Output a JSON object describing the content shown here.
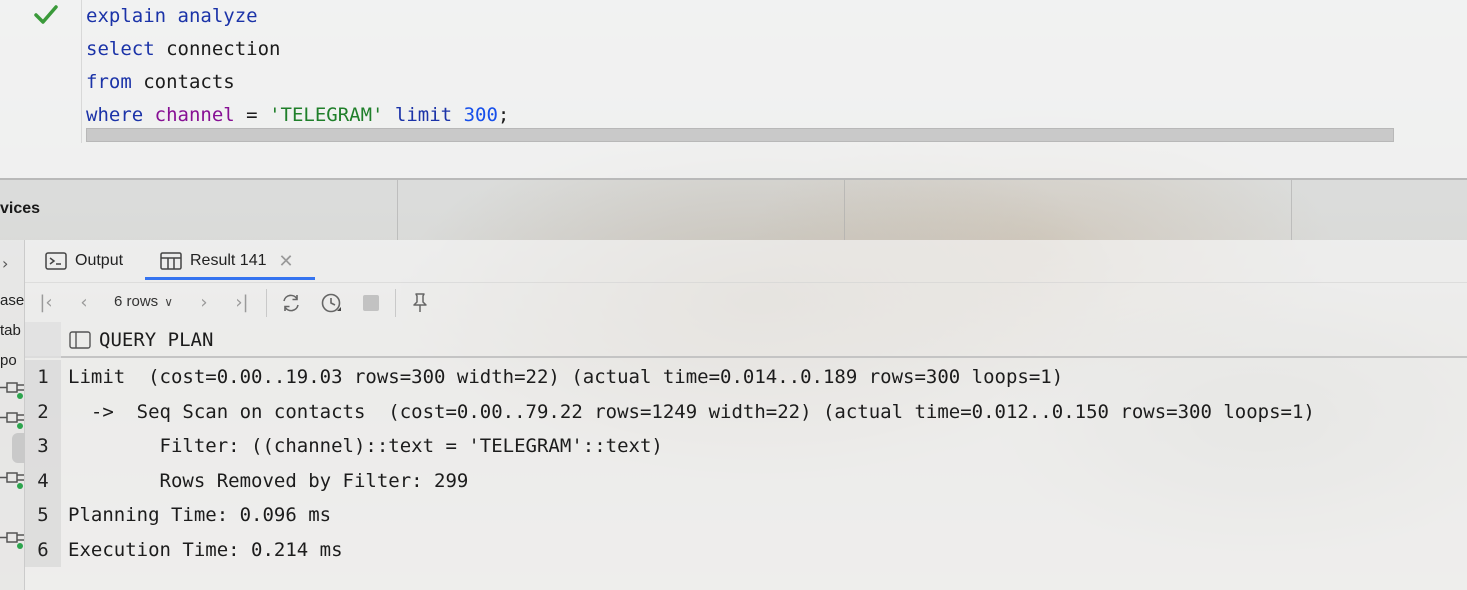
{
  "editor": {
    "status_icon": "check-icon",
    "lines": [
      [
        "explain",
        " ",
        "analyze"
      ],
      [
        "select",
        " connection"
      ],
      [
        "from",
        " contacts"
      ],
      [
        "where",
        " ",
        "channel",
        " = ",
        "'TELEGRAM'",
        " ",
        "limit",
        " ",
        "300",
        ";"
      ]
    ]
  },
  "services": {
    "title": "vices"
  },
  "left_rail": {
    "labels": [
      "ase",
      "tab",
      "po"
    ]
  },
  "tabs": [
    {
      "label": "Output",
      "icon": "console-icon"
    },
    {
      "label": "Result 141",
      "icon": "table-icon",
      "close_icon": "close-icon"
    }
  ],
  "toolbar": {
    "rows_label": "6 rows",
    "icons": [
      "first-page-icon",
      "prev-page-icon",
      "next-page-icon",
      "last-page-icon",
      "reload-icon",
      "history-icon",
      "stop-icon",
      "pin-icon"
    ]
  },
  "grid": {
    "column": "QUERY PLAN",
    "rows": [
      {
        "n": "1",
        "text": "Limit  (cost=0.00..19.03 rows=300 width=22) (actual time=0.014..0.189 rows=300 loops=1)"
      },
      {
        "n": "2",
        "text": "  ->  Seq Scan on contacts  (cost=0.00..79.22 rows=1249 width=22) (actual time=0.012..0.150 rows=300 loops=1)"
      },
      {
        "n": "3",
        "text": "        Filter: ((channel)::text = 'TELEGRAM'::text)"
      },
      {
        "n": "4",
        "text": "        Rows Removed by Filter: 299"
      },
      {
        "n": "5",
        "text": "Planning Time: 0.096 ms"
      },
      {
        "n": "6",
        "text": "Execution Time: 0.214 ms"
      }
    ]
  },
  "colors": {
    "keyword": "#1b33a8",
    "column": "#871094",
    "string": "#1f7f2a",
    "number": "#1750eb",
    "tab_underline": "#3574f0",
    "check": "#3a9a3a"
  }
}
